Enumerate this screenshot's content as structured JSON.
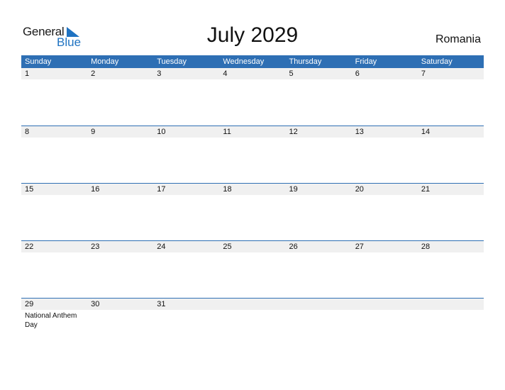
{
  "logo": {
    "general": "General",
    "blue": "Blue"
  },
  "title": "July 2029",
  "country": "Romania",
  "colors": {
    "accent": "#2e6fb4",
    "day_row_bg": "#f0f0f0",
    "logo_blue": "#1f73c2"
  },
  "weekdays": [
    "Sunday",
    "Monday",
    "Tuesday",
    "Wednesday",
    "Thursday",
    "Friday",
    "Saturday"
  ],
  "weeks": [
    [
      {
        "day": "1"
      },
      {
        "day": "2"
      },
      {
        "day": "3"
      },
      {
        "day": "4"
      },
      {
        "day": "5"
      },
      {
        "day": "6"
      },
      {
        "day": "7"
      }
    ],
    [
      {
        "day": "8"
      },
      {
        "day": "9"
      },
      {
        "day": "10"
      },
      {
        "day": "11"
      },
      {
        "day": "12"
      },
      {
        "day": "13"
      },
      {
        "day": "14"
      }
    ],
    [
      {
        "day": "15"
      },
      {
        "day": "16"
      },
      {
        "day": "17"
      },
      {
        "day": "18"
      },
      {
        "day": "19"
      },
      {
        "day": "20"
      },
      {
        "day": "21"
      }
    ],
    [
      {
        "day": "22"
      },
      {
        "day": "23"
      },
      {
        "day": "24"
      },
      {
        "day": "25"
      },
      {
        "day": "26"
      },
      {
        "day": "27"
      },
      {
        "day": "28"
      }
    ],
    [
      {
        "day": "29",
        "event": "National Anthem Day"
      },
      {
        "day": "30"
      },
      {
        "day": "31"
      },
      {
        "day": ""
      },
      {
        "day": ""
      },
      {
        "day": ""
      },
      {
        "day": ""
      }
    ]
  ]
}
